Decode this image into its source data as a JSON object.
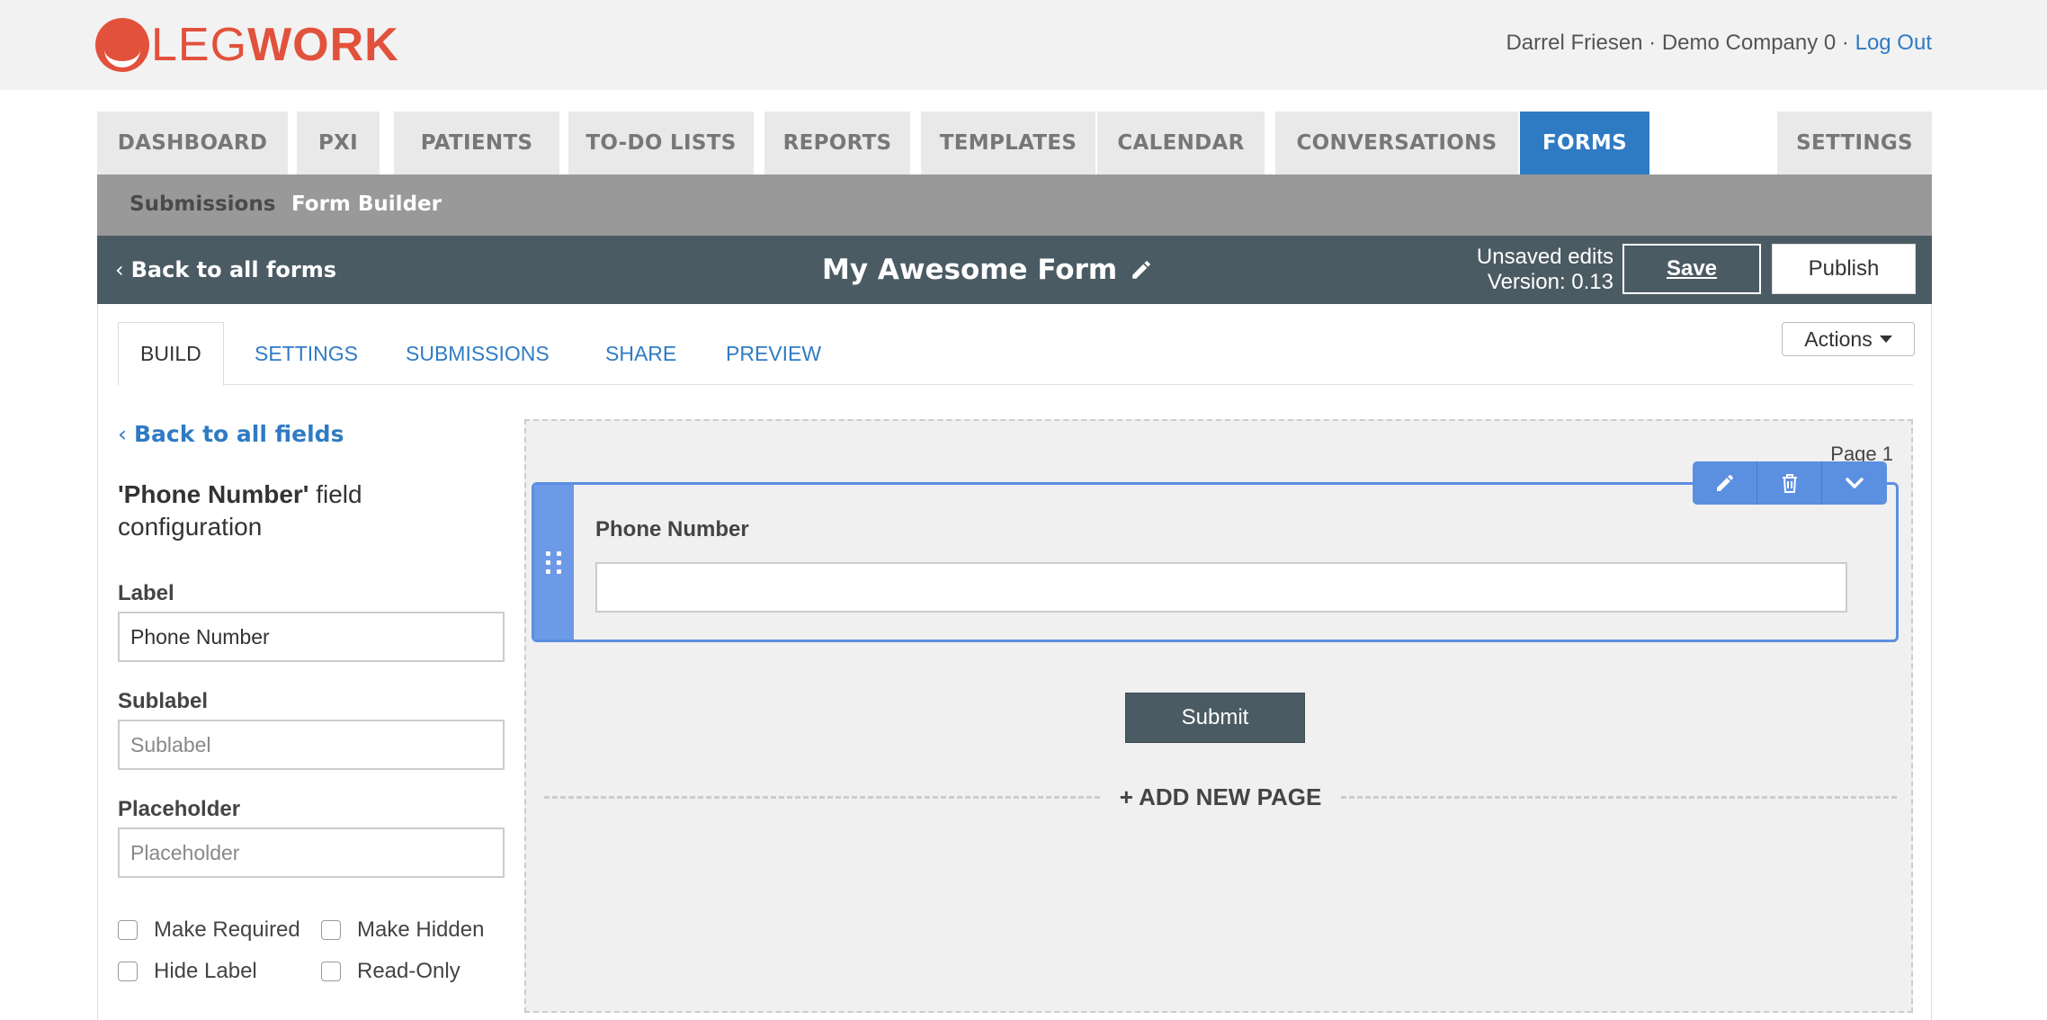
{
  "header": {
    "logo_text_light": "LEG",
    "logo_text_bold": "WORK",
    "user_name": "Darrel Friesen",
    "separator": " · ",
    "company": "Demo Company 0",
    "logout": "Log Out"
  },
  "nav": {
    "tabs": [
      {
        "label": "DASHBOARD"
      },
      {
        "label": "PXI"
      },
      {
        "label": "PATIENTS"
      },
      {
        "label": "TO-DO LISTS"
      },
      {
        "label": "REPORTS"
      },
      {
        "label": "TEMPLATES"
      },
      {
        "label": "CALENDAR"
      },
      {
        "label": "CONVERSATIONS"
      },
      {
        "label": "FORMS"
      },
      {
        "label": "SETTINGS"
      }
    ],
    "active": "FORMS"
  },
  "subnav": {
    "submissions": "Submissions",
    "form_builder": "Form Builder"
  },
  "form_header": {
    "back": "Back to all forms",
    "title": "My Awesome Form",
    "status_line1": "Unsaved edits",
    "status_line2": "Version: 0.13",
    "save": "Save",
    "publish": "Publish"
  },
  "tabs": {
    "items": [
      {
        "label": "BUILD"
      },
      {
        "label": "SETTINGS"
      },
      {
        "label": "SUBMISSIONS"
      },
      {
        "label": "SHARE"
      },
      {
        "label": "PREVIEW"
      }
    ],
    "active": "BUILD",
    "actions": "Actions"
  },
  "config": {
    "back": "Back to all fields",
    "title_field": "'Phone Number'",
    "title_rest": " field configuration",
    "label_label": "Label",
    "label_value": "Phone Number",
    "sublabel_label": "Sublabel",
    "sublabel_placeholder": "Sublabel",
    "placeholder_label": "Placeholder",
    "placeholder_placeholder": "Placeholder",
    "checks": {
      "required": "Make Required",
      "hidden": "Make Hidden",
      "hide_label": "Hide Label",
      "read_only": "Read-Only"
    }
  },
  "canvas": {
    "page_label": "Page 1",
    "field_label": "Phone Number",
    "submit": "Submit",
    "add_page": "+ ADD NEW PAGE"
  },
  "colors": {
    "brand": "#e2513b",
    "primary": "#2f7bc3",
    "header_dark": "#4b5b63",
    "field_highlight": "#5b8fe0"
  }
}
